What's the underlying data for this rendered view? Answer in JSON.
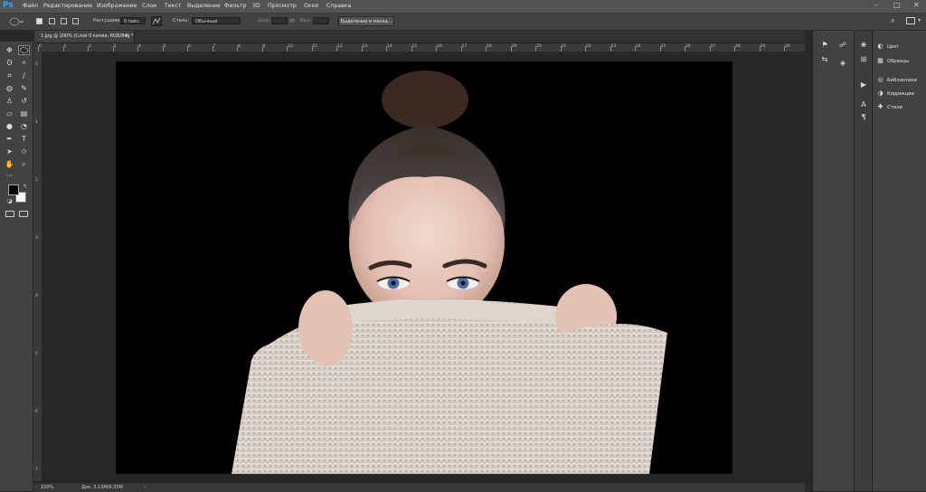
{
  "app": {
    "logo": "Ps"
  },
  "menubar": {
    "items": [
      "Файл",
      "Редактирование",
      "Изображение",
      "Слои",
      "Текст",
      "Выделение",
      "Фильтр",
      "3D",
      "Просмотр",
      "Окно",
      "Справка"
    ],
    "window_controls": {
      "minimize": "–",
      "maximize": "□",
      "close": "✕"
    }
  },
  "options": {
    "feather_label": "Растушевка:",
    "feather_value": "0 пикс.",
    "style_label": "Стиль:",
    "style_value": "Обычный",
    "width_label": "Шир.:",
    "height_label": "Выс.:",
    "select_mask_button": "Выделение и маска..."
  },
  "document": {
    "tab_title": "1.jpg @ 100% (Слой 0 копия, RGB/8#) *",
    "tab_close": "×"
  },
  "ruler": {
    "top_marks": [
      "0",
      "1",
      "2",
      "3",
      "4",
      "5",
      "6",
      "7",
      "8",
      "9",
      "10",
      "11",
      "12",
      "13",
      "14",
      "15",
      "16",
      "17",
      "18",
      "19",
      "20",
      "21",
      "22",
      "23",
      "24",
      "25",
      "26",
      "27",
      "28",
      "29",
      "30"
    ],
    "left_marks": [
      "0",
      "1",
      "2",
      "3",
      "4",
      "5",
      "6",
      "7"
    ]
  },
  "status": {
    "zoom": "100%",
    "doc_size": "Док: 3,13M/6,35M"
  },
  "panels": {
    "main_items": [
      {
        "label": "Цвет",
        "icon": "color-wheel-icon"
      },
      {
        "label": "Образцы",
        "icon": "swatches-icon"
      },
      {
        "label": "Библиотеки",
        "icon": "libraries-icon"
      },
      {
        "label": "Коррекция",
        "icon": "adjustments-icon"
      },
      {
        "label": "Стили",
        "icon": "styles-icon"
      }
    ]
  },
  "colors": {
    "foreground": "#000000",
    "background": "#ffffff",
    "accent": "#31a8ff"
  }
}
